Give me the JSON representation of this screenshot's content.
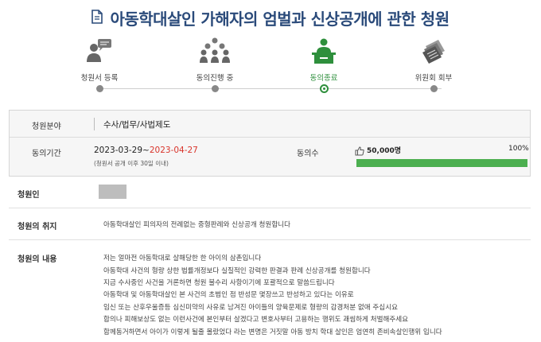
{
  "page": {
    "title": "아동학대살인 가해자의 엄벌과 신상공개에 관한 청원",
    "title_icon": "document-icon"
  },
  "colors": {
    "title": "#2a4a7a",
    "active_step": "#2e8f3c",
    "end_date": "#d9342b",
    "progress": "#4caf50"
  },
  "steps": [
    {
      "label": "청원서 등록",
      "icon": "speech-user-icon",
      "active": false
    },
    {
      "label": "동의진행 중",
      "icon": "group-icon",
      "active": false
    },
    {
      "label": "동의종료",
      "icon": "desk-presenter-icon",
      "active": true
    },
    {
      "label": "위원회 회부",
      "icon": "document-stack-icon",
      "active": false
    }
  ],
  "info": {
    "field_label": "청원분야",
    "field_value": "수사/법무/사법제도",
    "period_label": "동의기간",
    "period_start": "2023-03-29",
    "period_sep": "~",
    "period_end": "2023-04-27",
    "period_note": "(청원서 공개 이후 30일 이내)",
    "agree_label": "동의수",
    "agree_count": "50,000명",
    "agree_percent": "100%",
    "progress_fraction": 1.0
  },
  "petitioner": {
    "label": "청원인"
  },
  "purpose": {
    "label": "청원의 취지",
    "text": "아동학대살인 피의자의 전례없는 중형판례와 신상공개 청원합니다"
  },
  "content": {
    "label": "청원의 내용",
    "lines": [
      "저는 얼마전 아동학대로 살해당한 한 아이의 삼촌입니다",
      "아동학대 사건의 형량 상한 법률개정보다 실질적인 강력한 판결과 판례 신상공개를 청원합니다",
      "지금 수사중인 사건을 거론하면 청원 불수리 사항이기에 포괄적으로 말씀드립니다",
      "아동학대 및 아동학대살인  본 사건의 초범인 점 반성문 몇장쓰고 반성하고 있다는 이유로",
      "임신 또는 산후우울증등 심신미약의 사유로 남겨진 아이들의 양육문제로 형량의 감경처분 없애 주십시요",
      "합의나 피해보상도 없는 이런사건에 본인부터 살겠다고 변호사부터 고용하는 행위도 괘씸하게 처벌해주세요",
      "함께동거하면서 아이가 이렇게 될줄 몰랐었다 라는 변명은 거짓말 아동 방치 학대 살인은 엄연히 존비속살인행위 입니다"
    ]
  }
}
